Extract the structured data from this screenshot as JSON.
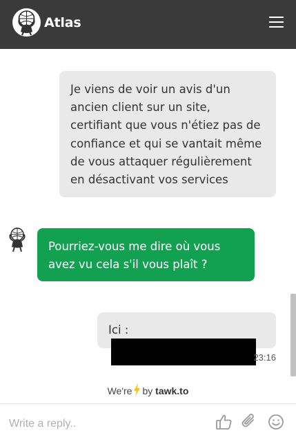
{
  "header": {
    "title": "Atlas",
    "avatar_icon": "atlas-logo-icon",
    "menu_icon": "hamburger-menu-icon",
    "background": "#3a3a3a"
  },
  "messages": [
    {
      "sender": "visitor",
      "text": "Je viens de voir un avis d'un ancien client sur un site, certifiant que vous n'étiez pas de confiance et qui se vantait même de vous attaquer régulièrement en désactivant vos services"
    },
    {
      "sender": "agent",
      "text": "Pourriez-vous me dire où vous avez vu cela s'il vous plaît ?"
    },
    {
      "sender": "visitor",
      "text": "Ici :",
      "redacted": true,
      "time": "23:16"
    }
  ],
  "branding": {
    "prefix": "We're",
    "by": "by",
    "brand": "tawk.to"
  },
  "composer": {
    "placeholder": "Write a reply..",
    "icons": [
      "thumbs-up-icon",
      "paperclip-icon",
      "emoji-icon"
    ]
  },
  "colors": {
    "agent_bubble": "#12a150",
    "visitor_bubble": "#e9e9e9",
    "bolt": "#f5c21b"
  }
}
